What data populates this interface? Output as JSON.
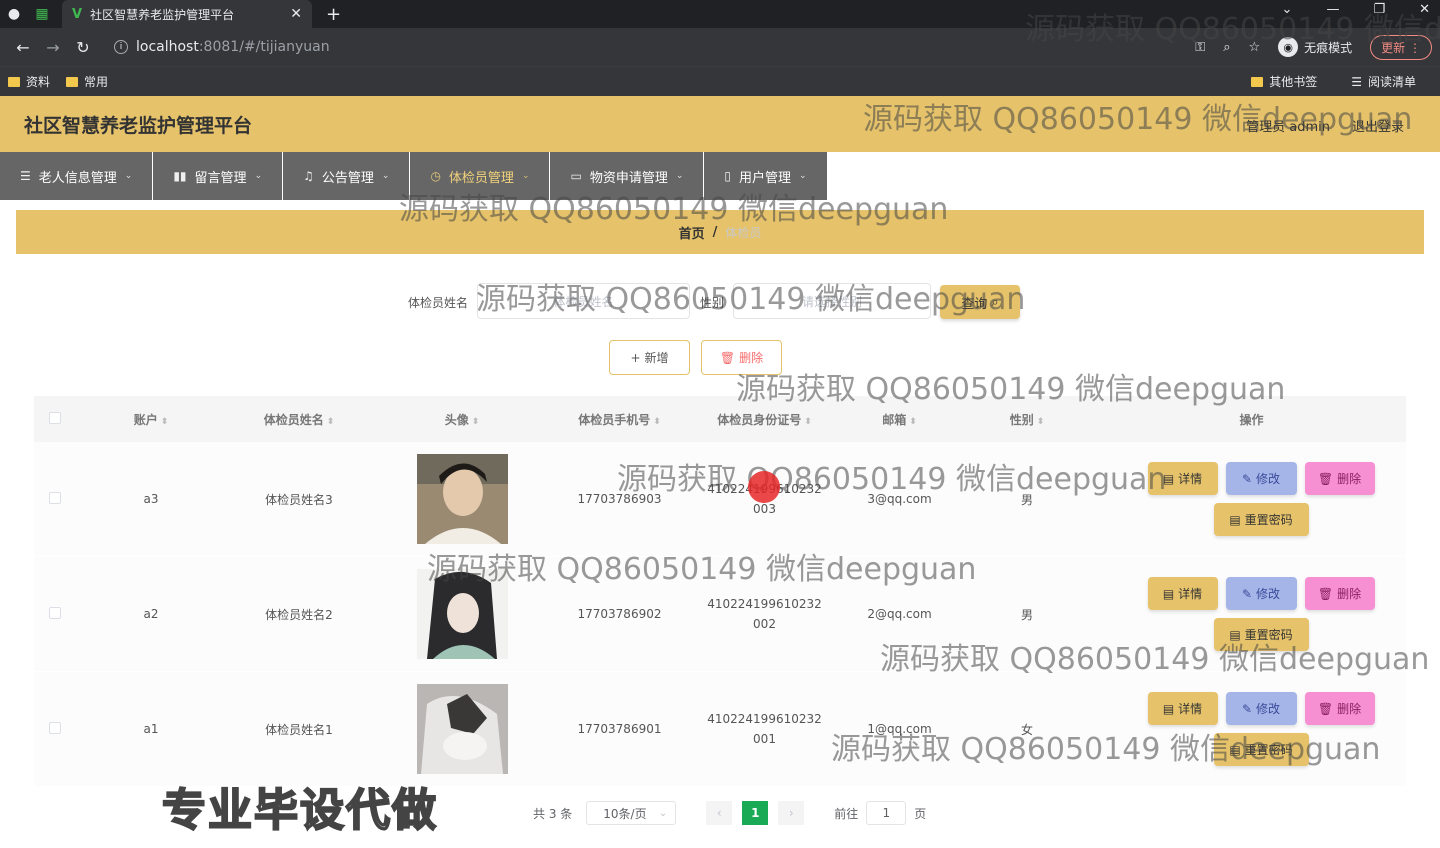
{
  "browser": {
    "tab_title": "社区智慧养老监护管理平台",
    "url_host": "localhost",
    "url_rest": ":8081/#/tijianyuan",
    "incognito_label": "无痕模式",
    "update_label": "更新",
    "bookmarks": [
      "资料",
      "常用"
    ],
    "other_bookmarks": "其他书签",
    "reading_list": "阅读清单"
  },
  "header": {
    "title": "社区智慧养老监护管理平台",
    "user": "管理员 admin",
    "logout": "退出登录"
  },
  "menu": [
    {
      "label": "老人信息管理",
      "icon": "list-icon"
    },
    {
      "label": "留言管理",
      "icon": "bar-chart-icon"
    },
    {
      "label": "公告管理",
      "icon": "bell-icon"
    },
    {
      "label": "体检员管理",
      "icon": "clock-icon"
    },
    {
      "label": "物资申请管理",
      "icon": "card-icon"
    },
    {
      "label": "用户管理",
      "icon": "phone-icon"
    }
  ],
  "breadcrumb": {
    "home": "首页",
    "sep": "/",
    "current": "体检员"
  },
  "search": {
    "name_label": "体检员姓名",
    "name_placeholder": "体检员姓名",
    "gender_label": "性别",
    "gender_placeholder": "请选择性别",
    "query_label": "查询"
  },
  "actions": {
    "add": "新增",
    "delete": "删除"
  },
  "table": {
    "headers": [
      "账户",
      "体检员姓名",
      "头像",
      "体检员手机号",
      "体检员身份证号",
      "邮箱",
      "性别",
      "操作"
    ],
    "rows": [
      {
        "account": "a3",
        "name": "体检员姓名3",
        "phone": "17703786903",
        "idcard": "410224199610232003",
        "email": "3@qq.com",
        "gender": "男"
      },
      {
        "account": "a2",
        "name": "体检员姓名2",
        "phone": "17703786902",
        "idcard": "410224199610232002",
        "email": "2@qq.com",
        "gender": "男"
      },
      {
        "account": "a1",
        "name": "体检员姓名1",
        "phone": "17703786901",
        "idcard": "410224199610232001",
        "email": "1@qq.com",
        "gender": "女"
      }
    ],
    "ops": {
      "detail": "详情",
      "edit": "修改",
      "delete": "删除",
      "reset": "重置密码"
    }
  },
  "pagination": {
    "total": "共 3 条",
    "size": "10条/页",
    "current": "1",
    "goto": "前往",
    "goto_value": "1",
    "page": "页"
  },
  "watermark": "源码获取 QQ86050149 微信deepguan",
  "promo": "专业毕设代做",
  "colors": {
    "accent": "#e6c36a",
    "menu": "#666666",
    "edit": "#a6b5e8",
    "delete": "#f78fd3",
    "page_active": "#1aaa55"
  }
}
